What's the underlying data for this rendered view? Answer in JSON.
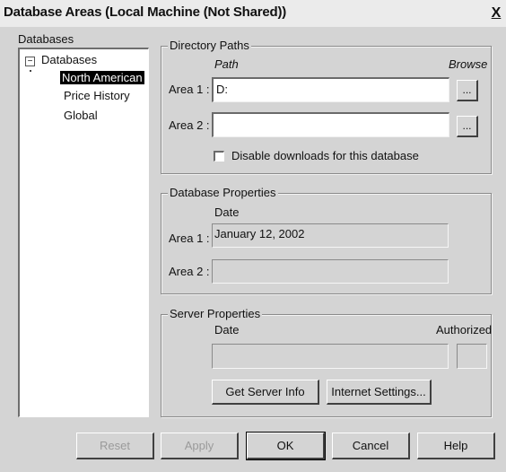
{
  "window": {
    "title": "Database Areas  (Local Machine (Not Shared))",
    "close_label": "X"
  },
  "databases": {
    "label": "Databases",
    "tree": {
      "root_label": "Databases",
      "toggle_glyph": "−",
      "items": [
        {
          "label": "North American",
          "selected": true
        },
        {
          "label": "Price History",
          "selected": false
        },
        {
          "label": "Global",
          "selected": false
        }
      ]
    }
  },
  "directory_paths": {
    "title": "Directory Paths",
    "path_header": "Path",
    "browse_header": "Browse",
    "area1_label": "Area 1 :",
    "area1_value": "D:",
    "area2_label": "Area 2 :",
    "area2_value": "",
    "browse_button_label": "...",
    "disable_downloads_label": "Disable downloads for this database",
    "disable_downloads_checked": false
  },
  "database_properties": {
    "title": "Database Properties",
    "date_header": "Date",
    "area1_label": "Area 1 :",
    "area1_value": "January 12, 2002",
    "area2_label": "Area 2 :",
    "area2_value": ""
  },
  "server_properties": {
    "title": "Server Properties",
    "date_header": "Date",
    "authorized_header": "Authorized",
    "date_value": "",
    "authorized_value": "",
    "get_server_info_label": "Get Server Info",
    "internet_settings_label": "Internet Settings..."
  },
  "footer": {
    "reset_label": "Reset",
    "apply_label": "Apply",
    "ok_label": "OK",
    "cancel_label": "Cancel",
    "help_label": "Help"
  }
}
